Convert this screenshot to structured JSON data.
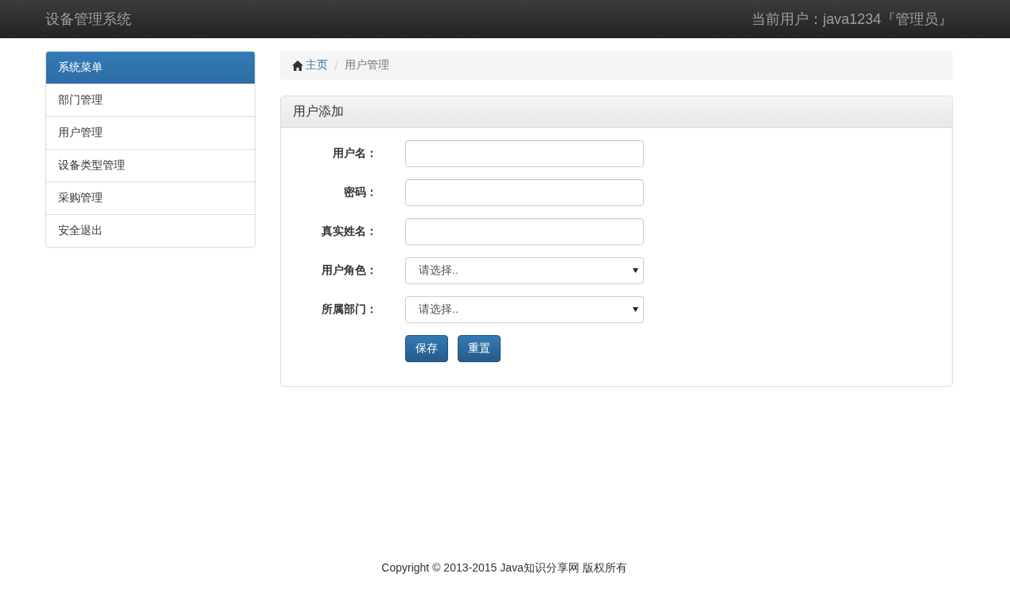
{
  "navbar": {
    "brand": "设备管理系统",
    "user": "当前用户：java1234『管理员』"
  },
  "sidebar": {
    "title": "系统菜单",
    "items": [
      {
        "label": "部门管理"
      },
      {
        "label": "用户管理"
      },
      {
        "label": "设备类型管理"
      },
      {
        "label": "采购管理"
      },
      {
        "label": "安全退出"
      }
    ]
  },
  "breadcrumb": [
    {
      "label": "主页",
      "kind": "link"
    },
    {
      "label": "用户管理",
      "kind": "current"
    }
  ],
  "panel": {
    "title": "用户添加",
    "fields": [
      {
        "label": "用户名：",
        "kind": "text"
      },
      {
        "label": "密码：",
        "kind": "text"
      },
      {
        "label": "真实姓名：",
        "kind": "text"
      },
      {
        "label": "用户角色：",
        "kind": "select",
        "value": "请选择.."
      },
      {
        "label": "所属部门：",
        "kind": "select",
        "value": "请选择.."
      }
    ],
    "buttons": [
      "保存",
      "重置"
    ]
  },
  "footer": "Copyright © 2013-2015 Java知识分享网 版权所有"
}
